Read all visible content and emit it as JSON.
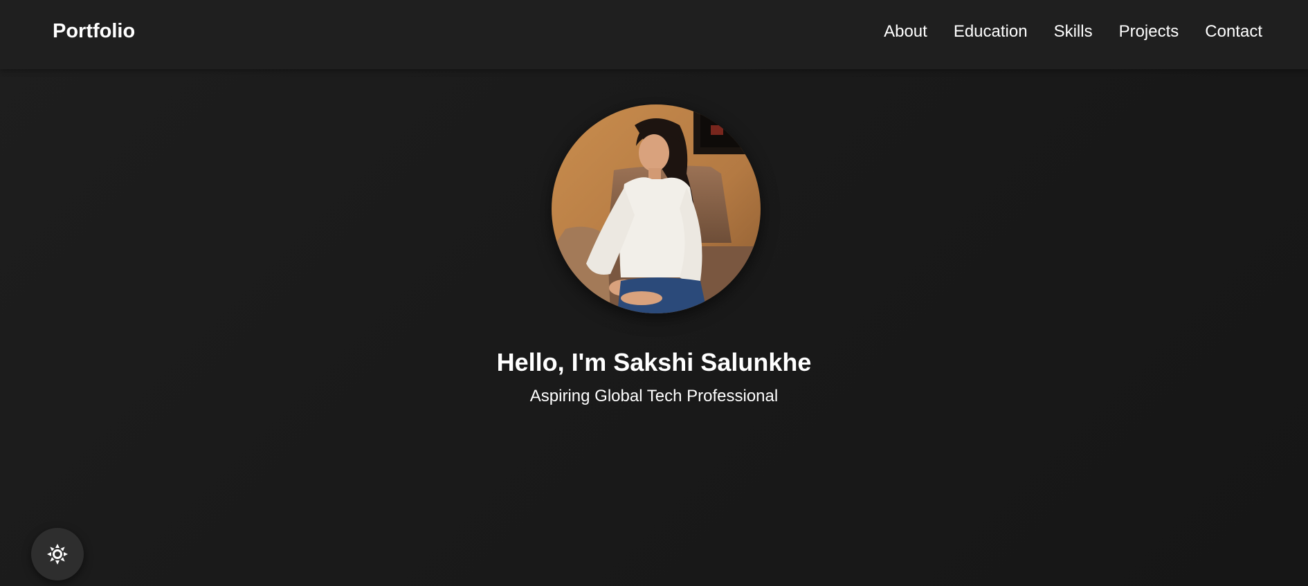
{
  "header": {
    "brand": "Portfolio",
    "nav": [
      "About",
      "Education",
      "Skills",
      "Projects",
      "Contact"
    ]
  },
  "hero": {
    "title": "Hello, I'm Sakshi Salunkhe",
    "subtitle": "Aspiring Global Tech Professional",
    "avatar_icon": "profile-photo"
  },
  "theme_toggle": {
    "icon": "sun-icon"
  },
  "colors": {
    "background": "#1b1b1b",
    "navbar": "#1f1f1f",
    "text": "#ffffff",
    "toggle_bg": "#2e2e2e"
  }
}
